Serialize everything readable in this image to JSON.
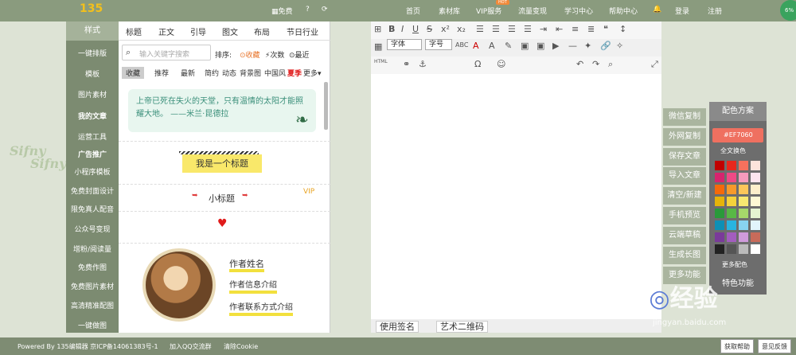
{
  "topbar": {
    "logo": "135",
    "free": "▦免费",
    "nav": [
      "首页",
      "素材库",
      "VIP服务",
      "流量变现",
      "学习中心",
      "帮助中心"
    ],
    "hot": "HOT",
    "login": "登录",
    "register": "注册"
  },
  "leftnav": [
    "样式",
    "一键排版",
    "模板",
    "图片素材",
    "我的文章",
    "运营工具",
    "广告推广",
    "小程序模板",
    "免费封面设计",
    "限免真人配音",
    "公众号变现",
    "增粉/阅读量",
    "免费作图",
    "免费图片素材",
    "高清精准配图",
    "一键做图"
  ],
  "tabs": [
    "标题",
    "正文",
    "引导",
    "图文",
    "布局",
    "节日行业"
  ],
  "search": {
    "placeholder": "输入关键字搜索",
    "sort_label": "排序:",
    "sort_options": [
      "⊙收藏",
      "⚡次数",
      "⊙最近"
    ]
  },
  "filters": [
    "收藏",
    "推荐",
    "最新",
    "简约",
    "动态",
    "背景图",
    "中国风",
    "夏季",
    "更多▾"
  ],
  "preview": {
    "quote": "上帝已死在失火的天堂，只有温情的太阳才能照耀大地。 ——米兰·昆德拉",
    "title1": "我是一个标题",
    "subtitle": "小标题",
    "vip": "VIP",
    "author_name": "作者姓名",
    "author_info": "作者信息介绍",
    "author_contact": "作者联系方式介绍"
  },
  "editor": {
    "font_dd": "字体",
    "size_dd": "字号",
    "sign": "使用签名",
    "qrcode": "艺术二维码"
  },
  "right_buttons": [
    "微信复制",
    "外网复制",
    "保存文章",
    "导入文章",
    "清空/新建",
    "手机预览",
    "云端草稿",
    "生成长图",
    "更多功能"
  ],
  "palette": {
    "title": "配色方案",
    "hex": "#EF7060",
    "whole": "全文换色",
    "more": "更多配色",
    "feature": "特色功能",
    "colors": [
      "#c00000",
      "#e8271d",
      "#f5715d",
      "#fde3dc",
      "#d6246e",
      "#ef4a86",
      "#f59bbd",
      "#fde5ef",
      "#f5690a",
      "#f79a2b",
      "#fbc65a",
      "#fdefcb",
      "#e6b40a",
      "#f5d23b",
      "#f8e871",
      "#fef9d4",
      "#2a9a3a",
      "#58b845",
      "#a6d76a",
      "#e4f4d1",
      "#0e8fb5",
      "#29b4e0",
      "#88d3f0",
      "#e2f4fc",
      "#7a3a9a",
      "#a35dbf",
      "#cf9bdb",
      "#c86b5a",
      "#222222",
      "#555555",
      "#bbbbbb",
      "#ffffff"
    ]
  },
  "footer": {
    "text": "Powered By 135编辑器 京ICP备14061383号-1",
    "qq": "加入QQ交流群",
    "cookie": "清除Cookie",
    "help": "获取帮助",
    "feedback": "意见反馈"
  },
  "fab": "6%"
}
